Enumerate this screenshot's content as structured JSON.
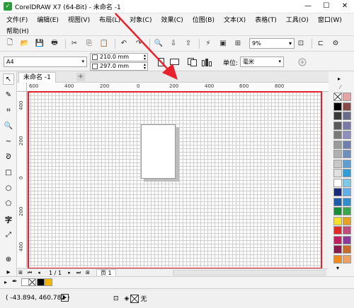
{
  "window": {
    "title": "CorelDRAW X7 (64-Bit) - 未命名 -1",
    "app_icon": "coreldraw-logo",
    "controls": [
      "minimize-icon",
      "maximize-icon",
      "close-icon"
    ]
  },
  "menu": {
    "items": [
      "文件(F)",
      "编辑(E)",
      "视图(V)",
      "布局(L)",
      "对象(C)",
      "效果(C)",
      "位图(B)",
      "文本(X)",
      "表格(T)",
      "工具(O)",
      "窗口(W)"
    ],
    "help": "帮助(H)"
  },
  "toolbar": {
    "zoom": "9%"
  },
  "property_bar": {
    "page_size": "A4",
    "width": "210.0 mm",
    "height": "297.0 mm",
    "unit_label": "单位:",
    "unit_value": "毫米"
  },
  "document": {
    "tab_label": "未命名 -1",
    "tab_add": "+"
  },
  "rulers": {
    "horizontal": [
      "600",
      "400",
      "200",
      "0",
      "200",
      "400",
      "600",
      "800"
    ],
    "vertical": [
      "400",
      "200",
      "0",
      "200",
      "400"
    ]
  },
  "page_nav": {
    "page_counter": "1 / 1",
    "page_tab": "页 1"
  },
  "status": {
    "coordinates": "( -43.894, 460.782 )",
    "fill_label": "无"
  },
  "palette": {
    "colors": [
      "#ffffff",
      "#e8a3a3",
      "#000000",
      "#8b4a4a",
      "#3a3a3a",
      "#6a6a8a",
      "#5a5a5a",
      "#7a78a8",
      "#7a7a7a",
      "#8f8fbf",
      "#9a9a9a",
      "#6f7fb0",
      "#b0b0b0",
      "#6d8fc0",
      "#c8c8c8",
      "#5a9fd6",
      "#e0e0e0",
      "#2d9ed8",
      "#ffffff",
      "#7ec8e8",
      "#1a2a7a",
      "#5fb0e8",
      "#1f5ca8",
      "#2e8fd0",
      "#1a8c3a",
      "#3aa84a",
      "#f5e02a",
      "#e8a020",
      "#e02a2a",
      "#c04a7a",
      "#c02060",
      "#8a3a9a",
      "#8a1a4a",
      "#c86a2a",
      "#f08a1a",
      "#f0a060"
    ],
    "doc_palette": [
      "#000000",
      "#f5b400"
    ]
  },
  "annotation_color": "#e8222c"
}
